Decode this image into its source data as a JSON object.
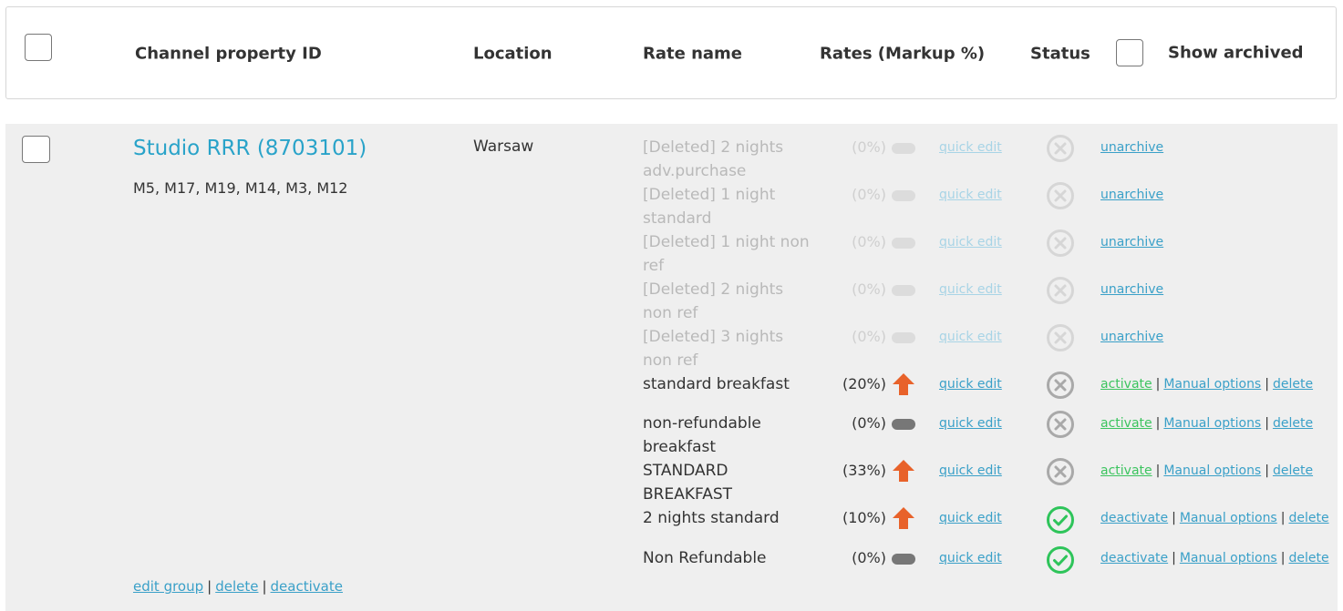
{
  "header": {
    "col_property": "Channel property ID",
    "col_location": "Location",
    "col_rate": "Rate name",
    "col_rates": "Rates (Markup %)",
    "col_status": "Status",
    "show_archived": "Show archived"
  },
  "property": {
    "name": "Studio RRR (8703101)",
    "markets": "M5, M17, M19, M14, M3, M12",
    "location": "Warsaw",
    "footer": {
      "edit_group": "edit group",
      "delete": "delete",
      "deactivate": "deactivate"
    }
  },
  "rates": [
    {
      "name": "[Deleted] 2 nights adv.purchase",
      "markup": "(0%)",
      "quick_edit": "quick edit",
      "action": "unarchive"
    },
    {
      "name": "[Deleted] 1 night standard",
      "markup": "(0%)",
      "quick_edit": "quick edit",
      "action": "unarchive"
    },
    {
      "name": "[Deleted] 1 night non ref",
      "markup": "(0%)",
      "quick_edit": "quick edit",
      "action": "unarchive"
    },
    {
      "name": "[Deleted] 2 nights non ref",
      "markup": "(0%)",
      "quick_edit": "quick edit",
      "action": "unarchive"
    },
    {
      "name": "[Deleted] 3 nights non ref",
      "markup": "(0%)",
      "quick_edit": "quick edit",
      "action": "unarchive"
    },
    {
      "name": "standard breakfast",
      "markup": "(20%)",
      "quick_edit": "quick edit",
      "action1": "activate",
      "action2": "Manual options",
      "action3": "delete"
    },
    {
      "name": "non-refundable breakfast",
      "markup": "(0%)",
      "quick_edit": "quick edit",
      "action1": "activate",
      "action2": "Manual options",
      "action3": "delete"
    },
    {
      "name": "STANDARD BREAKFAST",
      "markup": "(33%)",
      "quick_edit": "quick edit",
      "action1": "activate",
      "action2": "Manual options",
      "action3": "delete"
    },
    {
      "name": "2 nights standard",
      "markup": "(10%)",
      "quick_edit": "quick edit",
      "action1": "deactivate",
      "action2": "Manual options",
      "action3": "delete"
    },
    {
      "name": "Non Refundable",
      "markup": "(0%)",
      "quick_edit": "quick edit",
      "action1": "deactivate",
      "action2": "Manual options",
      "action3": "delete"
    }
  ],
  "separator": "|",
  "colors": {
    "link": "#3aa0c8",
    "activate": "#3cc45f",
    "up_arrow": "#e8622a",
    "active": "#2ec45a",
    "inactive": "#a9a9a9"
  },
  "icons": {
    "status_inactive": "circle-x-icon",
    "status_active": "circle-check-icon",
    "markup_up": "arrow-up-icon",
    "markup_zero": "flat-pill-icon"
  }
}
